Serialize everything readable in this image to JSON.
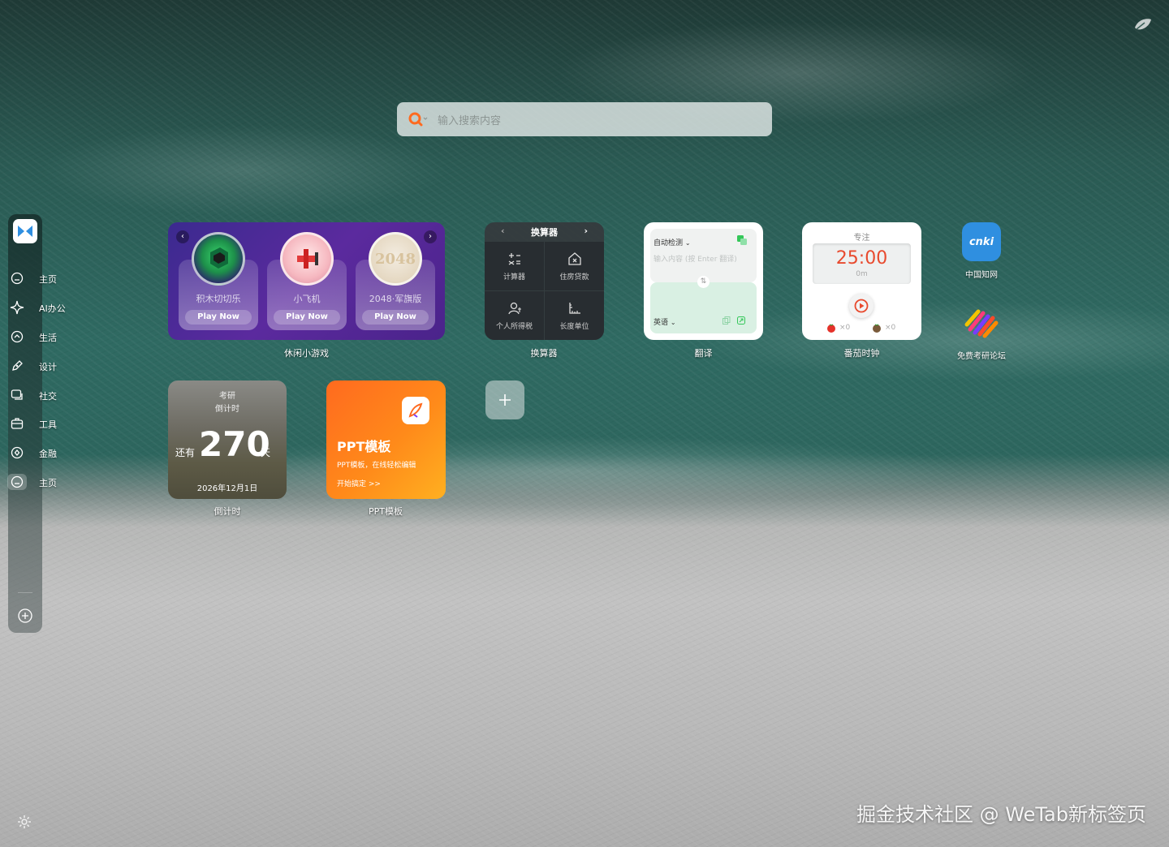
{
  "search": {
    "placeholder": "输入搜索内容",
    "engine_icon": "search-engine-icon",
    "accent": "#ff6a1f"
  },
  "sidebar": {
    "items": [
      {
        "label": "主页",
        "icon": "home-icon"
      },
      {
        "label": "AI办公",
        "icon": "sparkle-icon"
      },
      {
        "label": "生活",
        "icon": "house-icon"
      },
      {
        "label": "设计",
        "icon": "pen-icon"
      },
      {
        "label": "社交",
        "icon": "chat-icon"
      },
      {
        "label": "工具",
        "icon": "toolbox-icon"
      },
      {
        "label": "金融",
        "icon": "coin-icon"
      },
      {
        "label": "主页",
        "icon": "home-icon"
      }
    ],
    "active_index": 7
  },
  "games": {
    "label": "休闲小游戏",
    "cards": [
      {
        "name": "积木切切乐",
        "action": "Play Now"
      },
      {
        "name": "小飞机",
        "action": "Play Now"
      },
      {
        "name": "2048·军旗版",
        "action": "Play Now"
      }
    ],
    "thumb_text": "2048"
  },
  "converter": {
    "title": "换算器",
    "label": "换算器",
    "items": [
      "计算器",
      "住房贷款",
      "个人所得税",
      "长度单位"
    ]
  },
  "translate": {
    "label": "翻译",
    "source_lang": "自动检测",
    "hint": "输入内容 (按 Enter 翻译)",
    "target_lang": "英语"
  },
  "pomodoro": {
    "label": "番茄时钟",
    "mode": "专注",
    "time": "25:00",
    "elapsed": "0m",
    "tomato_count": "×0",
    "rest_count": "×0",
    "accent": "#e84a2e"
  },
  "apps": [
    {
      "name": "中国知网",
      "icon_text": "cnki",
      "color": "#2f8fe0"
    },
    {
      "name": "免费考研论坛",
      "icon": "stripes-icon"
    }
  ],
  "countdown": {
    "label": "倒计时",
    "line1": "考研",
    "line2": "倒计时",
    "prefix": "还有",
    "days": "270",
    "unit": "天",
    "date": "2026年12月1日"
  },
  "ppt": {
    "label": "PPT模板",
    "title": "PPT模板",
    "desc": "PPT模板，在线轻松编辑",
    "cta": "开始搞定 >>"
  },
  "watermark": "掘金技术社区 @ WeTab新标签页"
}
